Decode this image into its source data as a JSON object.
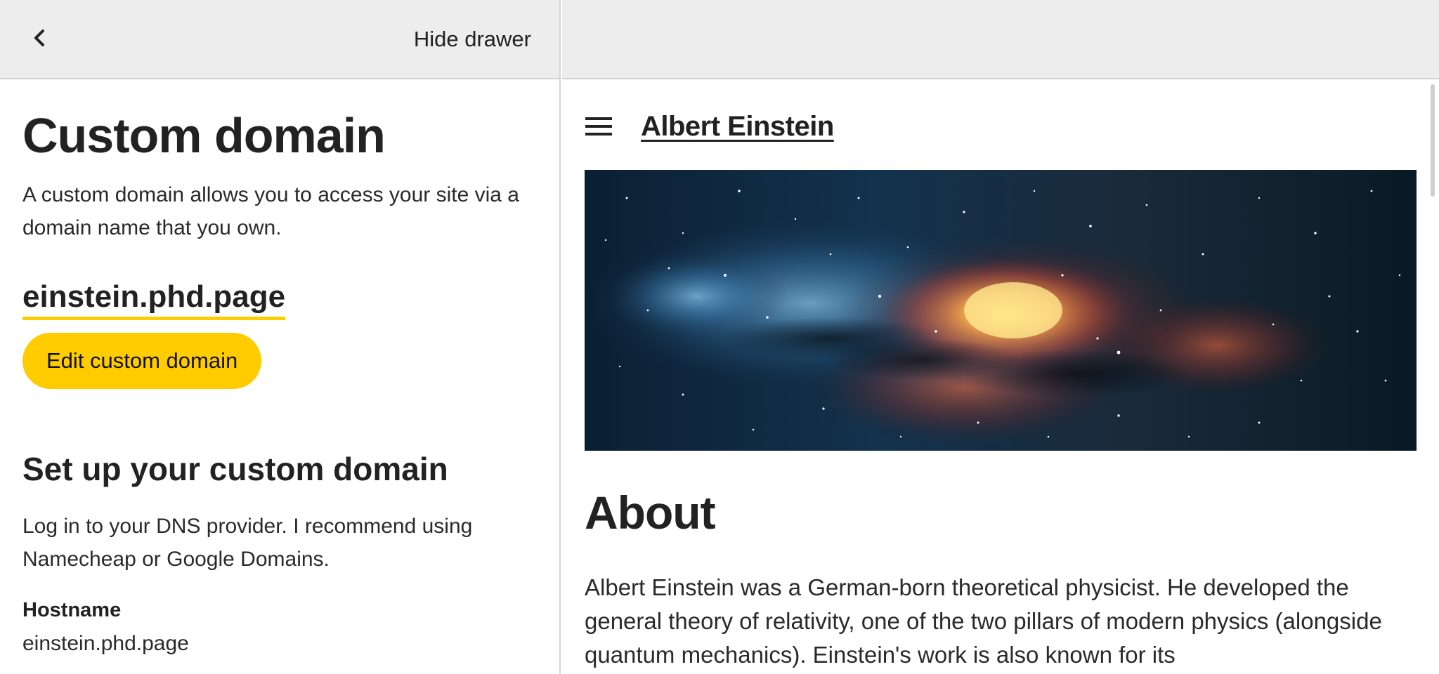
{
  "drawer": {
    "back_icon": "chevron-left-icon",
    "hide_label": "Hide drawer",
    "title": "Custom domain",
    "description": "A custom domain allows you to access your site via a domain name that you own.",
    "domain": "einstein.phd.page",
    "edit_button_label": "Edit custom domain",
    "setup_title": "Set up your custom domain",
    "setup_text": "Log in to your DNS provider. I recommend using Namecheap or Google Domains.",
    "hostname_label": "Hostname",
    "hostname_value": "einstein.phd.page"
  },
  "preview": {
    "menu_icon": "hamburger-menu-icon",
    "site_title": "Albert Einstein",
    "hero_image": "galaxy-nebula-image",
    "about_heading": "About",
    "about_text": "Albert Einstein was a German-born theoretical physicist. He developed the general theory of relativity, one of the two pillars of modern physics (alongside quantum mechanics). Einstein's work is also known for its"
  },
  "colors": {
    "accent": "#ffcc00",
    "topbar_bg": "#ededed",
    "text": "#222222"
  }
}
